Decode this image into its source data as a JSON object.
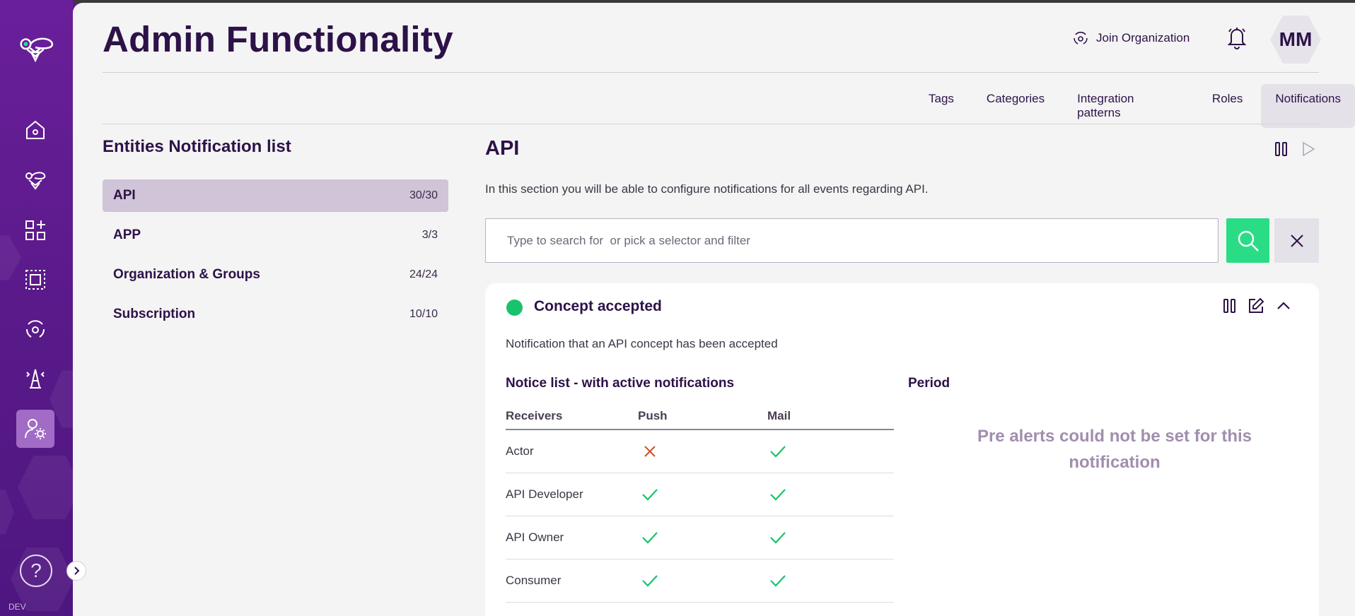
{
  "env_label": "DEV",
  "page": {
    "title": "Admin Functionality"
  },
  "header": {
    "join_org_label": "Join Organization",
    "avatar_initials": "MM"
  },
  "tabs": [
    {
      "label": "Tags",
      "active": false
    },
    {
      "label": "Categories",
      "active": false
    },
    {
      "label": "Integration patterns",
      "active": false
    },
    {
      "label": "Roles",
      "active": false
    },
    {
      "label": "Notifications",
      "active": true
    }
  ],
  "entities": {
    "title": "Entities Notification list",
    "items": [
      {
        "name": "API",
        "count": "30/30",
        "active": true
      },
      {
        "name": "APP",
        "count": "3/3",
        "active": false
      },
      {
        "name": "Organization & Groups",
        "count": "24/24",
        "active": false
      },
      {
        "name": "Subscription",
        "count": "10/10",
        "active": false
      }
    ]
  },
  "section": {
    "title": "API",
    "description": "In this section you will be able to configure notifications for all events regarding API.",
    "search_placeholder": "Type to search for  or pick a selector and filter"
  },
  "card": {
    "title": "Concept accepted",
    "status_color": "#18c36b",
    "description": "Notification that an API concept has been accepted",
    "notice_title": "Notice list - with active notifications",
    "period_title": "Period",
    "period_message": "Pre alerts could not be set for this notification",
    "columns": [
      "Receivers",
      "Push",
      "Mail"
    ],
    "rows": [
      {
        "receiver": "Actor",
        "push": false,
        "mail": true
      },
      {
        "receiver": "API Developer",
        "push": true,
        "mail": true
      },
      {
        "receiver": "API Owner",
        "push": true,
        "mail": true
      },
      {
        "receiver": "Consumer",
        "push": true,
        "mail": true
      }
    ]
  },
  "colors": {
    "brand_purple": "#5b1a8c",
    "accent_green": "#2bdc86",
    "check_green": "#18c36b",
    "cross_red": "#c8502a"
  }
}
